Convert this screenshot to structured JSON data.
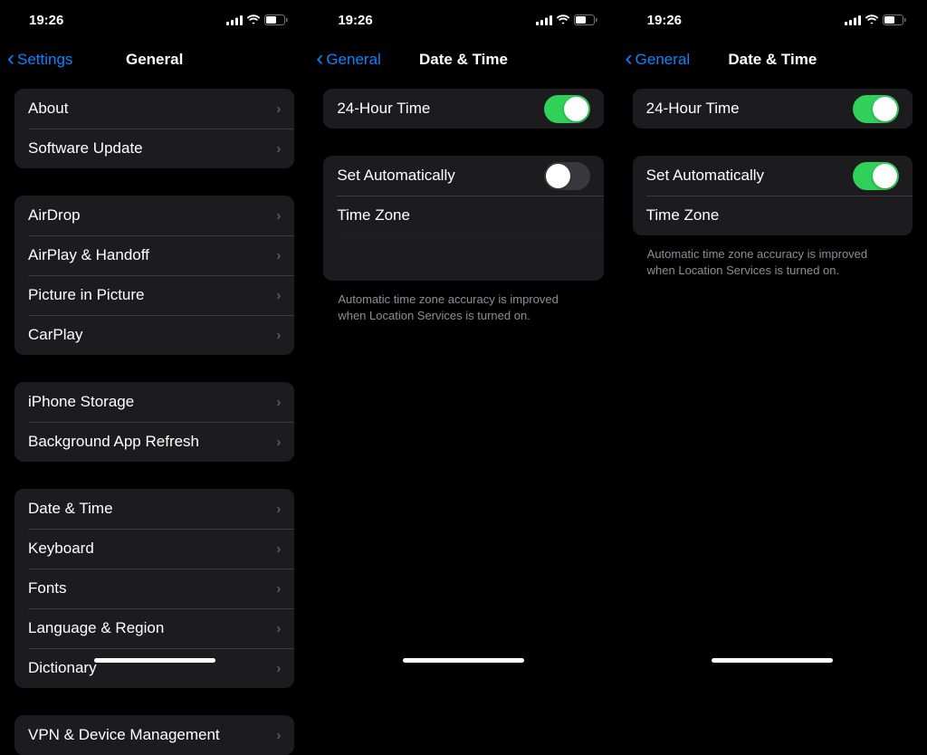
{
  "status": {
    "time": "19:26"
  },
  "p1": {
    "back": "Settings",
    "title": "General",
    "g1": [
      "About",
      "Software Update"
    ],
    "g2": [
      "AirDrop",
      "AirPlay & Handoff",
      "Picture in Picture",
      "CarPlay"
    ],
    "g3": [
      "iPhone Storage",
      "Background App Refresh"
    ],
    "g4": [
      "Date & Time",
      "Keyboard",
      "Fonts",
      "Language & Region",
      "Dictionary"
    ],
    "g5": [
      "VPN & Device Management"
    ]
  },
  "p2": {
    "back": "General",
    "title": "Date & Time",
    "rows": {
      "r1_label": "24-Hour Time",
      "r2_label": "Set Automatically",
      "r3_label": "Time Zone"
    },
    "footer": "Automatic time zone accuracy is improved when Location Services is turned on."
  },
  "p3": {
    "back": "General",
    "title": "Date & Time",
    "rows": {
      "r1_label": "24-Hour Time",
      "r2_label": "Set Automatically",
      "r3_label": "Time Zone"
    },
    "footer": "Automatic time zone accuracy is improved when Location Services is turned on."
  }
}
